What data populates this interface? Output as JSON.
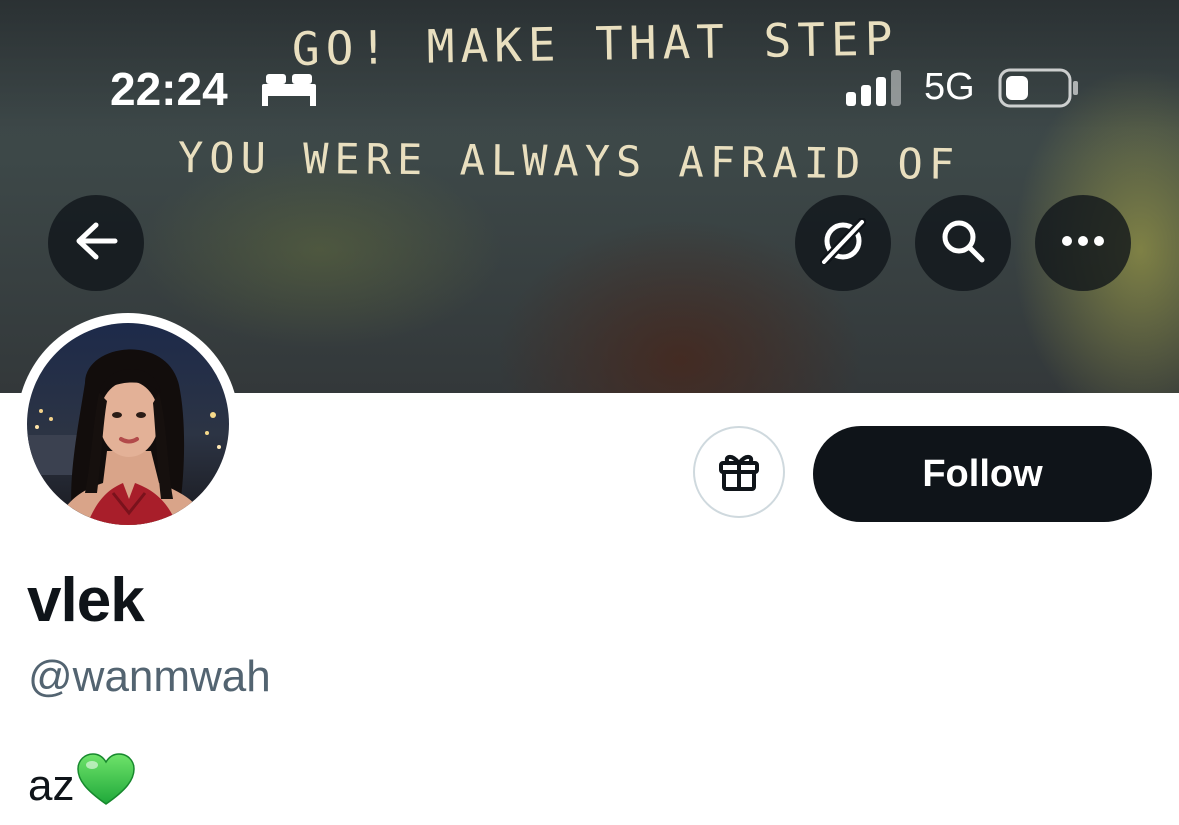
{
  "status_bar": {
    "time": "22:24",
    "network": "5G",
    "focus_icon": "bed-icon",
    "signal_icon": "cellular-signal-icon",
    "battery_icon": "battery-low-icon"
  },
  "banner": {
    "wall_text_line1": "GO! MAKE THAT STEP",
    "wall_text_line2": "YOU WERE ALWAYS AFRAID OF"
  },
  "header_actions": {
    "back_icon": "arrow-left-icon",
    "grok_icon": "grok-icon",
    "search_icon": "search-icon",
    "more_icon": "more-horizontal-icon"
  },
  "profile": {
    "display_name": "vlek",
    "handle": "@wanmwah",
    "bio_text": "az",
    "bio_emoji": "green-heart-emoji"
  },
  "actions": {
    "gift_icon": "gift-icon",
    "follow_label": "Follow"
  },
  "colors": {
    "primary_text": "#0f1419",
    "secondary_text": "#536471",
    "follow_bg": "#0f1419",
    "border": "#cfd9de",
    "heart": "#2ecc40"
  }
}
